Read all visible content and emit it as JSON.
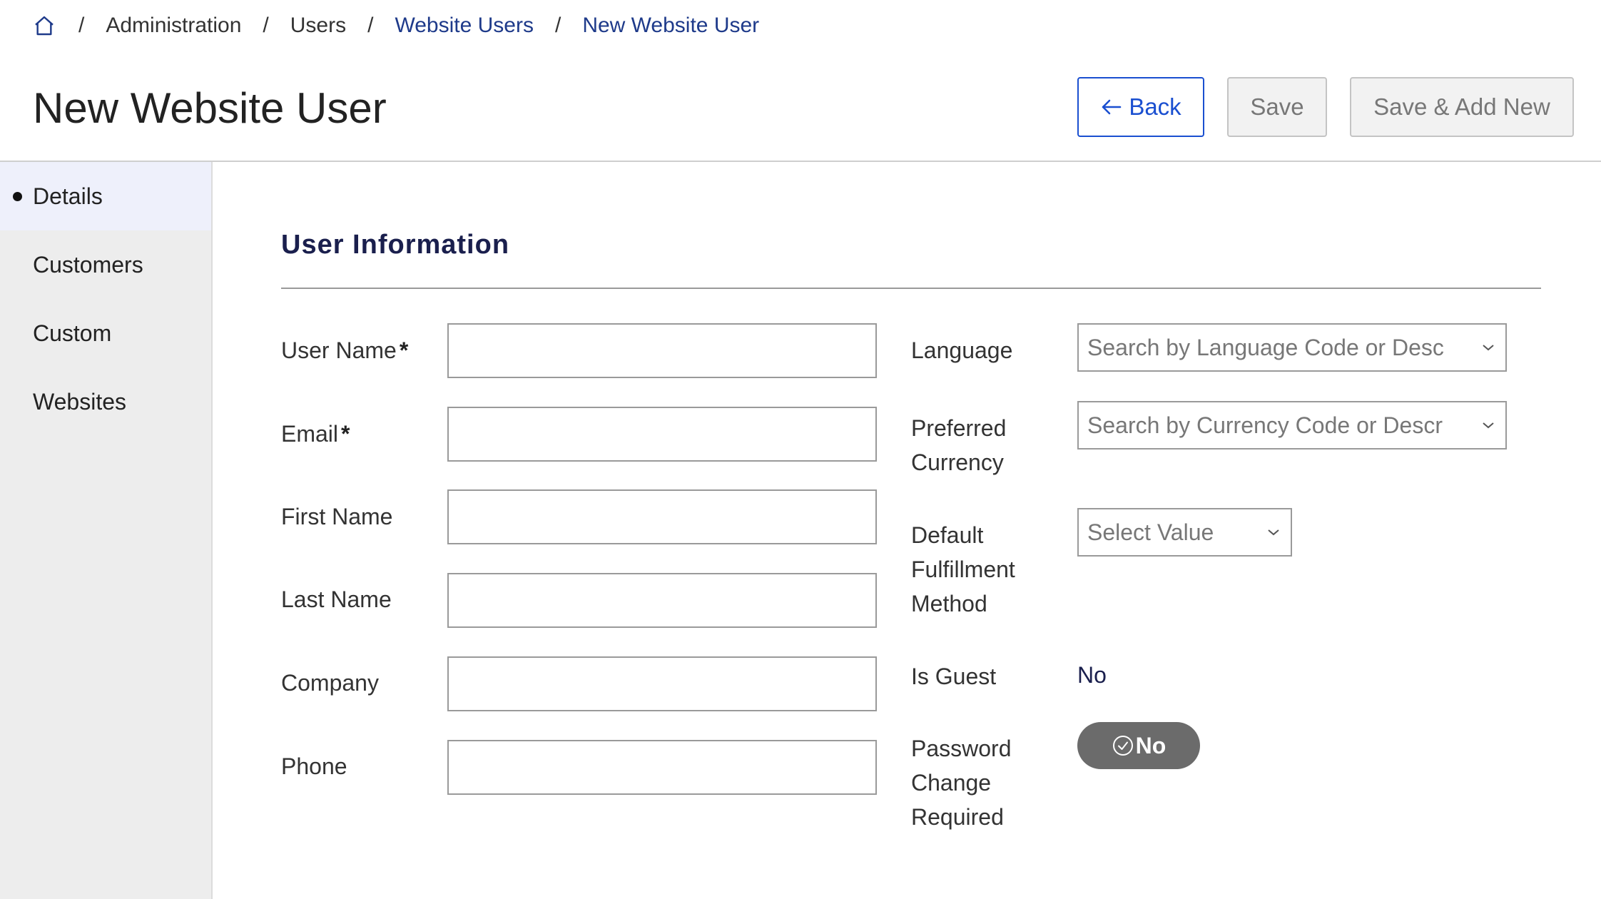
{
  "breadcrumb": {
    "home_icon": "home-icon",
    "items": [
      "Administration",
      "Users",
      "Website Users",
      "New Website User"
    ],
    "separator": "/"
  },
  "page": {
    "title": "New Website User"
  },
  "toolbar": {
    "back_label": "Back",
    "save_label": "Save",
    "save_add_label": "Save & Add New"
  },
  "sidebar": {
    "items": [
      {
        "label": "Details",
        "active": true
      },
      {
        "label": "Customers",
        "active": false
      },
      {
        "label": "Custom",
        "active": false
      },
      {
        "label": "Websites",
        "active": false
      }
    ]
  },
  "section": {
    "title": "User Information"
  },
  "form": {
    "user_name": {
      "label": "User Name",
      "required": "*",
      "value": ""
    },
    "email": {
      "label": "Email",
      "required": "*",
      "value": ""
    },
    "first_name": {
      "label": "First Name",
      "value": ""
    },
    "last_name": {
      "label": "Last Name",
      "value": ""
    },
    "company": {
      "label": "Company",
      "value": ""
    },
    "phone": {
      "label": "Phone",
      "value": ""
    },
    "language": {
      "label": "Language",
      "placeholder": "Search by Language Code or Desc"
    },
    "currency": {
      "label_line1": "Preferred",
      "label_line2": "Currency",
      "placeholder": "Search by Currency Code or Descr"
    },
    "fulfillment": {
      "label_line1": "Default",
      "label_line2": "Fulfillment",
      "label_line3": "Method",
      "placeholder": "Select Value"
    },
    "is_guest": {
      "label": "Is Guest",
      "value": "No"
    },
    "password_change": {
      "label_line1": "Password",
      "label_line2": "Change",
      "label_line3": "Required",
      "toggle_value": "No"
    }
  },
  "colors": {
    "accent": "#1a4fd0",
    "link": "#1e3a8a",
    "toggle_bg": "#6b6b6b",
    "sidebar_bg": "#ededed",
    "sidebar_active_bg": "#eef0fb"
  }
}
